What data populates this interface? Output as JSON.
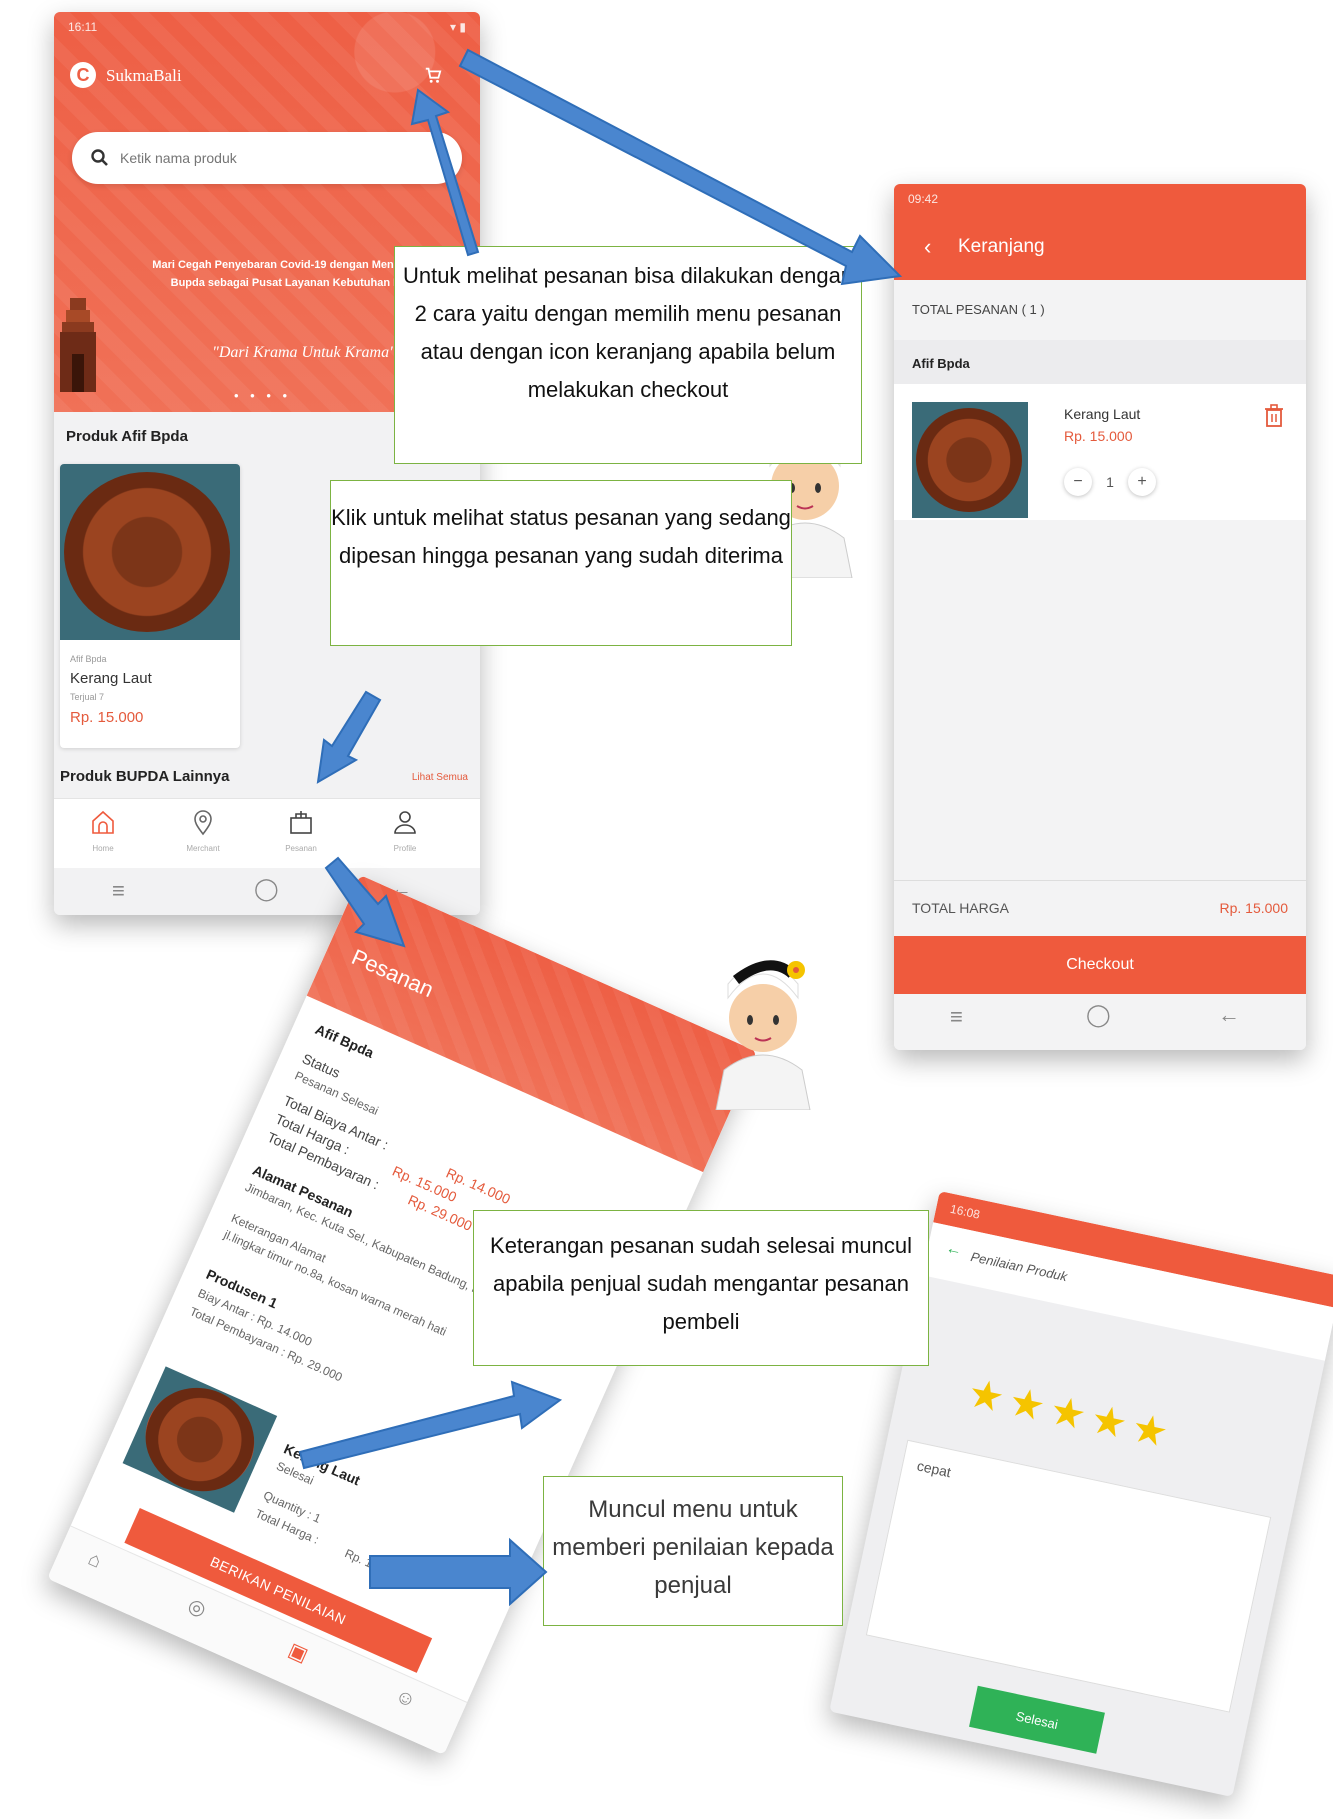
{
  "colors": {
    "brand": "#ef5a3d",
    "accent_price": "#e45a3c",
    "success": "#2fb257",
    "star": "#f5c400",
    "note_border": "#7cb342",
    "arrow": "#4a86cf"
  },
  "home": {
    "status_time": "16:11",
    "brand": "SukmaBali",
    "search_placeholder": "Ketik nama produk",
    "banner_text": "Mari Cegah Penyebaran Covid-19 dengan Menggunakan Bupda sebagai Pusat Layanan Kebutuhan Krama",
    "banner_script": "\"Dari Krama Untuk Krama\"",
    "dots": "• • • •",
    "section_title": "Produk Afif Bpda",
    "product": {
      "shop": "Afif Bpda",
      "name": "Kerang Laut",
      "sold": "Terjual 7",
      "price": "Rp. 15.000"
    },
    "section2_title": "Produk BUPDA Lainnya",
    "see_all": "Lihat Semua",
    "nav": [
      {
        "label": "Home",
        "icon": "home-icon"
      },
      {
        "label": "Merchant",
        "icon": "location-icon"
      },
      {
        "label": "Pesanan",
        "icon": "bag-icon"
      },
      {
        "label": "Profile",
        "icon": "user-icon"
      }
    ]
  },
  "cart": {
    "status_time": "09:42",
    "title": "Keranjang",
    "total_orders": "TOTAL PESANAN ( 1 )",
    "shop": "Afif Bpda",
    "item": {
      "name": "Kerang Laut",
      "price": "Rp. 15.000",
      "qty": "1"
    },
    "total_label": "TOTAL HARGA",
    "total_value": "Rp. 15.000",
    "checkout": "Checkout"
  },
  "orders": {
    "title": "Pesanan",
    "shop": "Afif Bpda",
    "status_label": "Status",
    "status_value": "Pesanan Selesai",
    "ongkir": "Total Biaya Antar :",
    "ongkir_val": "Rp. 14.000",
    "harga": "Total Harga :",
    "harga_val": "Rp. 15.000",
    "bayar": "Total Pembayaran :",
    "bayar_val": "Rp. 29.000",
    "alamat_label": "Alamat Pesanan",
    "alamat_value": "Jimbaran, Kec. Kuta Sel., Kabupaten Badung, Bali, Indonesia",
    "ket_label": "Keterangan Alamat",
    "ket_value": "jl.lingkar timur no.8a, kosan warna merah hati",
    "producer": "Produsen 1",
    "p_ongkir": "Biay Antar : Rp. 14.000",
    "p_total": "Total Pembayaran : Rp. 29.000",
    "item_name": "Kerang Laut",
    "item_status": "Selesai",
    "item_qty": "Quantity : 1",
    "item_total": "Total Harga :",
    "item_total_val": "Rp. 15.000",
    "rate_button": "BERIKAN PENILAIAN"
  },
  "rating": {
    "status_time": "16:08",
    "title": "Penilaian Produk",
    "stars": "★★★★★",
    "comment": "cepat",
    "submit": "Selesai"
  },
  "notes": {
    "n1": "Untuk melihat pesanan bisa dilakukan dengan 2 cara yaitu dengan memilih menu pesanan atau dengan icon keranjang apabila belum melakukan checkout",
    "n2": "Klik untuk melihat status pesanan yang sedang dipesan hingga pesanan yang sudah diterima",
    "n3": "Keterangan pesanan sudah selesai muncul apabila penjual sudah mengantar pesanan pembeli",
    "n4": "Muncul menu untuk memberi penilaian kepada penjual"
  }
}
